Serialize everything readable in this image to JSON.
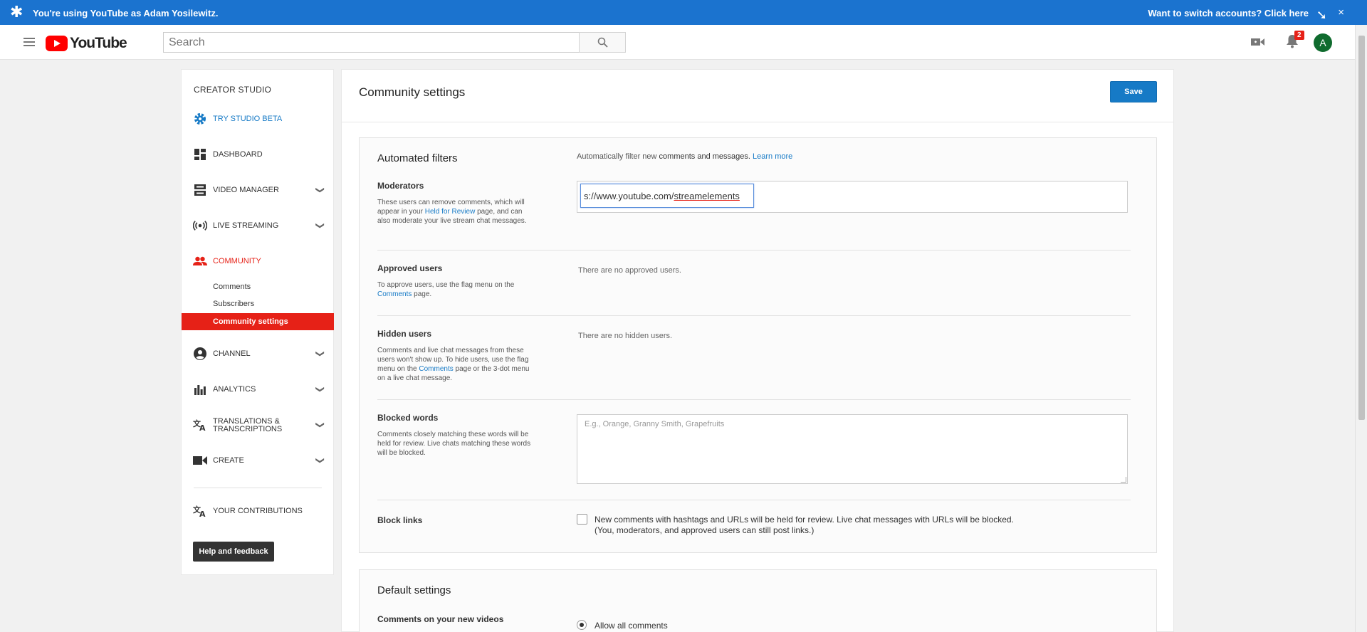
{
  "banner": {
    "message": "You're using YouTube as Adam Yosilewitz.",
    "switch_text": "Want to switch accounts? Click here",
    "close_glyph": "×",
    "star_glyph": "✱",
    "arrow_glyph": "➘"
  },
  "masthead": {
    "logo_text": "YouTube",
    "search_placeholder": "Search",
    "notification_count": "2",
    "avatar_letter": "A"
  },
  "sidebar": {
    "title": "CREATOR STUDIO",
    "items": [
      {
        "label": "TRY STUDIO BETA",
        "icon": "gear-icon"
      },
      {
        "label": "DASHBOARD",
        "icon": "dashboard-icon"
      },
      {
        "label": "VIDEO MANAGER",
        "icon": "video-manager-icon"
      },
      {
        "label": "LIVE STREAMING",
        "icon": "live-streaming-icon"
      },
      {
        "label": "COMMUNITY",
        "icon": "community-icon"
      },
      {
        "label": "CHANNEL",
        "icon": "channel-icon"
      },
      {
        "label": "ANALYTICS",
        "icon": "analytics-icon"
      },
      {
        "label": "TRANSLATIONS &",
        "label2": "TRANSCRIPTIONS",
        "icon": "translate-icon"
      },
      {
        "label": "CREATE",
        "icon": "create-icon"
      },
      {
        "label": "YOUR CONTRIBUTIONS",
        "icon": "contributions-icon"
      }
    ],
    "community_sub": [
      "Comments",
      "Subscribers",
      "Community settings"
    ],
    "help_label": "Help and feedback",
    "chevron": "❯"
  },
  "main": {
    "title": "Community settings",
    "save_label": "Save",
    "filters": {
      "title": "Automated filters",
      "desc_prefix": "Automatically filter new ",
      "desc_bold": "comments and messages.",
      "desc_link": "Learn more",
      "moderators": {
        "label": "Moderators",
        "help_1": "These users can remove comments, which will appear in your ",
        "help_link": "Held for Review",
        "help_2": " page, and can also moderate your live stream chat messages.",
        "input_prefix": "s://www.youtube.com/",
        "input_underlined": "streamelements"
      },
      "approved": {
        "label": "Approved users",
        "help_1": "To approve users, use the flag menu on the ",
        "help_link": "Comments",
        "help_2": " page.",
        "value": "There are no approved users."
      },
      "hidden": {
        "label": "Hidden users",
        "help_1": "Comments and live chat messages from these users won't show up. To hide users, use the flag menu on the ",
        "help_link": "Comments",
        "help_2": " page or the 3-dot menu on a live chat message.",
        "value": "There are no hidden users."
      },
      "blocked": {
        "label": "Blocked words",
        "help": "Comments closely matching these words will be held for review. Live chats matching these words will be blocked.",
        "placeholder": "E.g., Orange, Granny Smith, Grapefruits"
      },
      "links": {
        "label": "Block links",
        "text_1": "New comments with hashtags and URLs will be held for review. Live chat messages with URLs will be blocked.",
        "text_2": "(You, moderators, and approved users can still post links.)",
        "checked": false
      }
    },
    "defaults": {
      "title": "Default settings",
      "row_label": "Comments on your new videos",
      "option": "Allow all comments"
    }
  }
}
